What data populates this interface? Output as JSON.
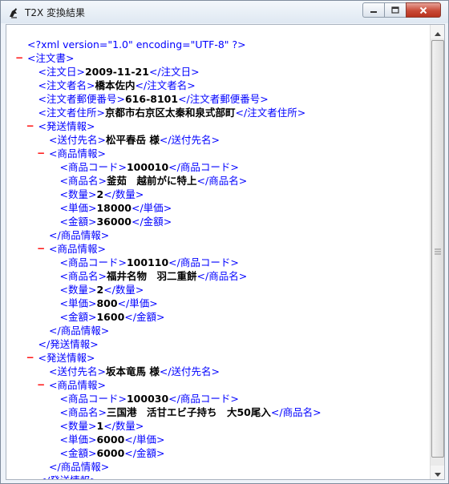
{
  "window": {
    "title": "T2X 変換結果",
    "app_icon": "bird-icon",
    "controls": [
      "minimize-icon",
      "maximize-icon",
      "close-icon"
    ]
  },
  "xml": {
    "declaration": "<?xml version=\"1.0\" encoding=\"UTF-8\" ?>",
    "lines": [
      {
        "indent": 0,
        "collapse": true,
        "open": "注文書"
      },
      {
        "indent": 1,
        "open": "注文日",
        "value": "2009-11-21",
        "close": "注文日"
      },
      {
        "indent": 1,
        "open": "注文者名",
        "value": "橋本佐内",
        "close": "注文者名"
      },
      {
        "indent": 1,
        "open": "注文者郵便番号",
        "value": "616-8101",
        "close": "注文者郵便番号"
      },
      {
        "indent": 1,
        "open": "注文者住所",
        "value": "京都市右京区太秦和泉式部町",
        "close": "注文者住所"
      },
      {
        "indent": 1,
        "collapse": true,
        "open": "発送情報"
      },
      {
        "indent": 2,
        "open": "送付先名",
        "value": "松平春岳 様",
        "close": "送付先名"
      },
      {
        "indent": 2,
        "collapse": true,
        "open": "商品情報"
      },
      {
        "indent": 3,
        "open": "商品コード",
        "value": "100010",
        "close": "商品コード"
      },
      {
        "indent": 3,
        "open": "商品名",
        "value": "釜茹　越前がに特上",
        "close": "商品名"
      },
      {
        "indent": 3,
        "open": "数量",
        "value": "2",
        "close": "数量"
      },
      {
        "indent": 3,
        "open": "単価",
        "value": "18000",
        "close": "単価"
      },
      {
        "indent": 3,
        "open": "金額",
        "value": "36000",
        "close": "金額"
      },
      {
        "indent": 2,
        "close": "商品情報"
      },
      {
        "indent": 2,
        "collapse": true,
        "open": "商品情報"
      },
      {
        "indent": 3,
        "open": "商品コード",
        "value": "100110",
        "close": "商品コード"
      },
      {
        "indent": 3,
        "open": "商品名",
        "value": "福井名物　羽二重餅",
        "close": "商品名"
      },
      {
        "indent": 3,
        "open": "数量",
        "value": "2",
        "close": "数量"
      },
      {
        "indent": 3,
        "open": "単価",
        "value": "800",
        "close": "単価"
      },
      {
        "indent": 3,
        "open": "金額",
        "value": "1600",
        "close": "金額"
      },
      {
        "indent": 2,
        "close": "商品情報"
      },
      {
        "indent": 1,
        "close": "発送情報"
      },
      {
        "indent": 1,
        "collapse": true,
        "open": "発送情報"
      },
      {
        "indent": 2,
        "open": "送付先名",
        "value": "坂本竜馬 様",
        "close": "送付先名"
      },
      {
        "indent": 2,
        "collapse": true,
        "open": "商品情報"
      },
      {
        "indent": 3,
        "open": "商品コード",
        "value": "100030",
        "close": "商品コード"
      },
      {
        "indent": 3,
        "open": "商品名",
        "value": "三国港　活甘エビ子持ち　大50尾入",
        "close": "商品名"
      },
      {
        "indent": 3,
        "open": "数量",
        "value": "1",
        "close": "数量"
      },
      {
        "indent": 3,
        "open": "単価",
        "value": "6000",
        "close": "単価"
      },
      {
        "indent": 3,
        "open": "金額",
        "value": "6000",
        "close": "金額"
      },
      {
        "indent": 2,
        "close": "商品情報"
      },
      {
        "indent": 1,
        "close": "発送情報"
      }
    ],
    "collapse_glyph": "−"
  },
  "colors": {
    "tag": "#0000ff",
    "collapse": "#ff0000",
    "value": "#000000"
  }
}
